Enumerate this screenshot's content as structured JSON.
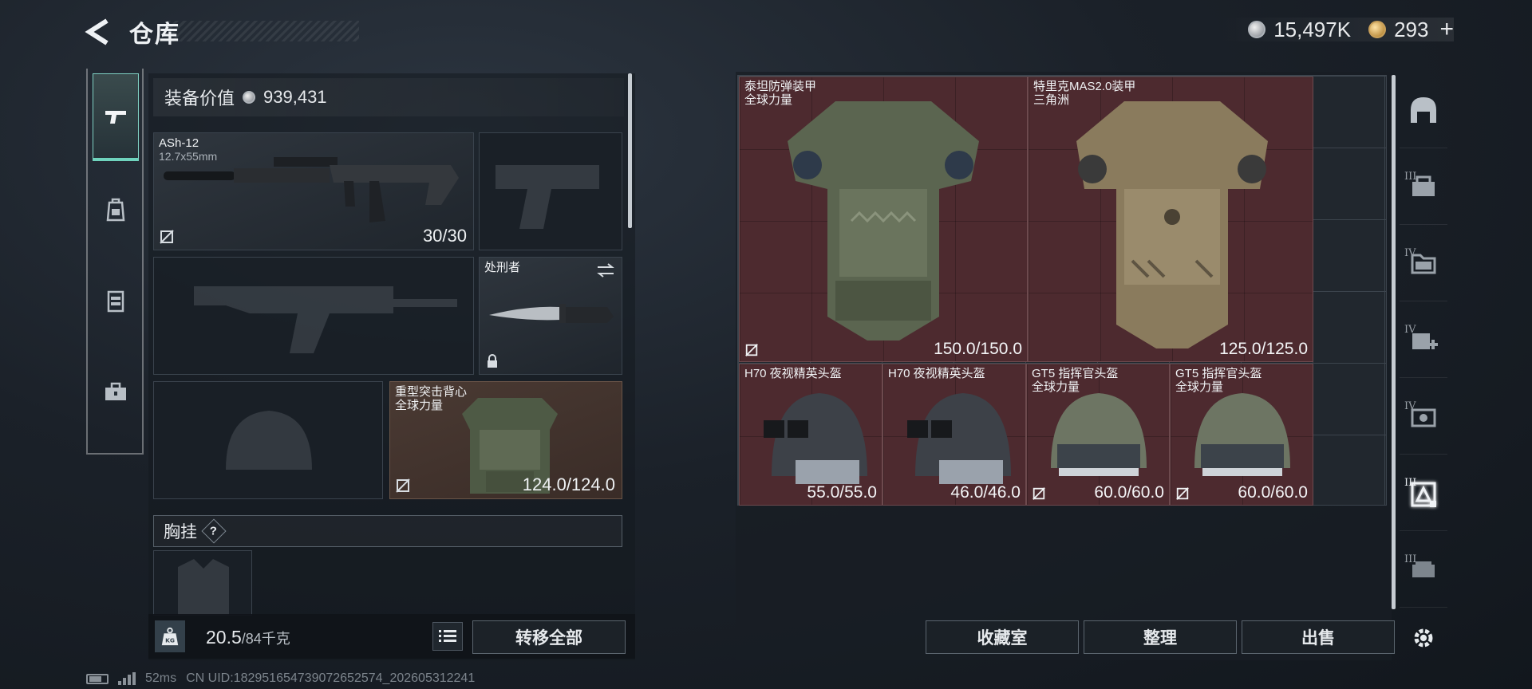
{
  "header": {
    "title": "仓库",
    "currencies": [
      {
        "icon": "silver-coin-icon",
        "value": "15,497K"
      },
      {
        "icon": "gold-coin-icon",
        "value": "293"
      }
    ],
    "add_symbol": "+"
  },
  "left_rail": {
    "tabs": [
      {
        "icon": "pistol-icon",
        "active": true
      },
      {
        "icon": "backpack-icon",
        "active": false
      },
      {
        "icon": "vest-icon",
        "active": false
      },
      {
        "icon": "toolbox-icon",
        "active": false
      }
    ]
  },
  "loadout": {
    "equip_value_label": "装备价值",
    "equip_value": "939,431",
    "primary_weapon": {
      "name": "ASh-12",
      "caliber": "12.7x55mm",
      "ammo": "30/30"
    },
    "melee": {
      "name": "处刑者"
    },
    "armor": {
      "name": "重型突击背心",
      "source": "全球力量",
      "durability": "124.0/124.0"
    },
    "chest_rig_label": "胸挂",
    "help_label": "?",
    "weight_value": "20.5",
    "weight_max": "/84千克",
    "transfer_all_label": "转移全部"
  },
  "storage": {
    "items": [
      {
        "name": "泰坦防弹装甲",
        "source": "全球力量",
        "durability": "150.0/150.0"
      },
      {
        "name": "特里克MAS2.0装甲",
        "source": "三角洲",
        "durability": "125.0/125.0"
      },
      {
        "name": "H70 夜视精英头盔",
        "source": "",
        "durability": "55.0/55.0"
      },
      {
        "name": "H70 夜视精英头盔",
        "source": "",
        "durability": "46.0/46.0"
      },
      {
        "name": "GT5 指挥官头盔",
        "source": "全球力量",
        "durability": "60.0/60.0"
      },
      {
        "name": "GT5 指挥官头盔",
        "source": "全球力量",
        "durability": "60.0/60.0"
      }
    ],
    "buttons": {
      "collection": "收藏室",
      "sort": "整理",
      "sell": "出售"
    }
  },
  "right_rail": {
    "items": [
      {
        "tier": "",
        "icon": "helmet-filter-icon"
      },
      {
        "tier": "III",
        "icon": "tier3-box-icon"
      },
      {
        "tier": "IV",
        "icon": "tier4-folder-icon"
      },
      {
        "tier": "IV",
        "icon": "tier4-medical-icon"
      },
      {
        "tier": "IV",
        "icon": "tier4-case-icon"
      },
      {
        "tier": "III",
        "icon": "tier3-armor-icon"
      },
      {
        "tier": "III",
        "icon": "tier3-crate-icon"
      }
    ],
    "settings_icon": "gear-icon"
  },
  "status": {
    "ping": "52ms",
    "uid": "CN UID:182951654739072652574_202605312241"
  }
}
